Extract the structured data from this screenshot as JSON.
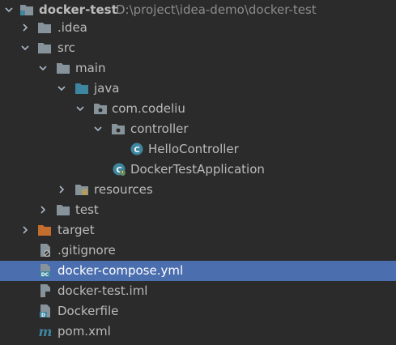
{
  "project": {
    "root_name": "docker-test",
    "root_path": "D:\\project\\idea-demo\\docker-test"
  },
  "items": [
    {
      "label": "docker-test"
    },
    {
      "label": ".idea"
    },
    {
      "label": "src"
    },
    {
      "label": "main"
    },
    {
      "label": "java"
    },
    {
      "label": "com.codeliu"
    },
    {
      "label": "controller"
    },
    {
      "label": "HelloController"
    },
    {
      "label": "DockerTestApplication"
    },
    {
      "label": "resources"
    },
    {
      "label": "test"
    },
    {
      "label": "target"
    },
    {
      "label": ".gitignore"
    },
    {
      "label": "docker-compose.yml"
    },
    {
      "label": "docker-test.iml"
    },
    {
      "label": "Dockerfile"
    },
    {
      "label": "pom.xml"
    }
  ],
  "selected_item": "docker-compose.yml",
  "colors": {
    "background": "#2b2b2b",
    "selection": "#4b6eaf",
    "text": "#bbbbbb",
    "path": "#8c8c8c",
    "folder": "#87939a",
    "source_folder": "#3e86a0",
    "excluded_folder": "#c36e2f",
    "class_icon": "#3e86a0"
  }
}
